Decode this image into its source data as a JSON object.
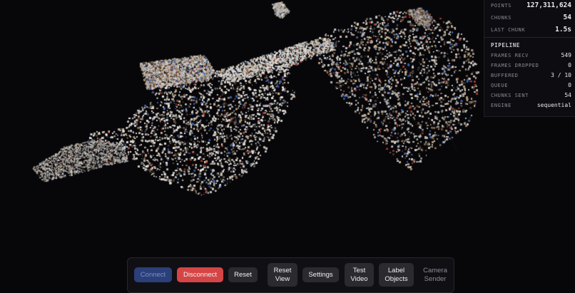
{
  "stats": {
    "points": {
      "label": "POINTS",
      "value": "127,311,624"
    },
    "chunks": {
      "label": "CHUNKS",
      "value": "54"
    },
    "last_chunk": {
      "label": "LAST CHUNK",
      "value": "1.5s"
    },
    "pipeline_title": "PIPELINE",
    "pipeline": [
      {
        "label": "FRAMES RECV",
        "value": "549"
      },
      {
        "label": "FRAMES DROPPED",
        "value": "0"
      },
      {
        "label": "BUFFERED",
        "value": "3 / 10"
      },
      {
        "label": "QUEUE",
        "value": "0"
      },
      {
        "label": "CHUNKS SENT",
        "value": "54"
      },
      {
        "label": "ENGINE",
        "value": "sequential"
      }
    ]
  },
  "toolbar": {
    "connect": "Connect",
    "disconnect": "Disconnect",
    "reset": "Reset",
    "reset_view": [
      "Reset",
      "View"
    ],
    "settings": "Settings",
    "test_video": [
      "Test",
      "Video"
    ],
    "label_objects": [
      "Label",
      "Objects"
    ],
    "camera_sender": [
      "Camera",
      "Sender"
    ]
  },
  "colors": {
    "background": "#07070a",
    "connect_disabled": "#2b3f78",
    "disconnect": "#d64545",
    "button": "#2a2a2f"
  }
}
